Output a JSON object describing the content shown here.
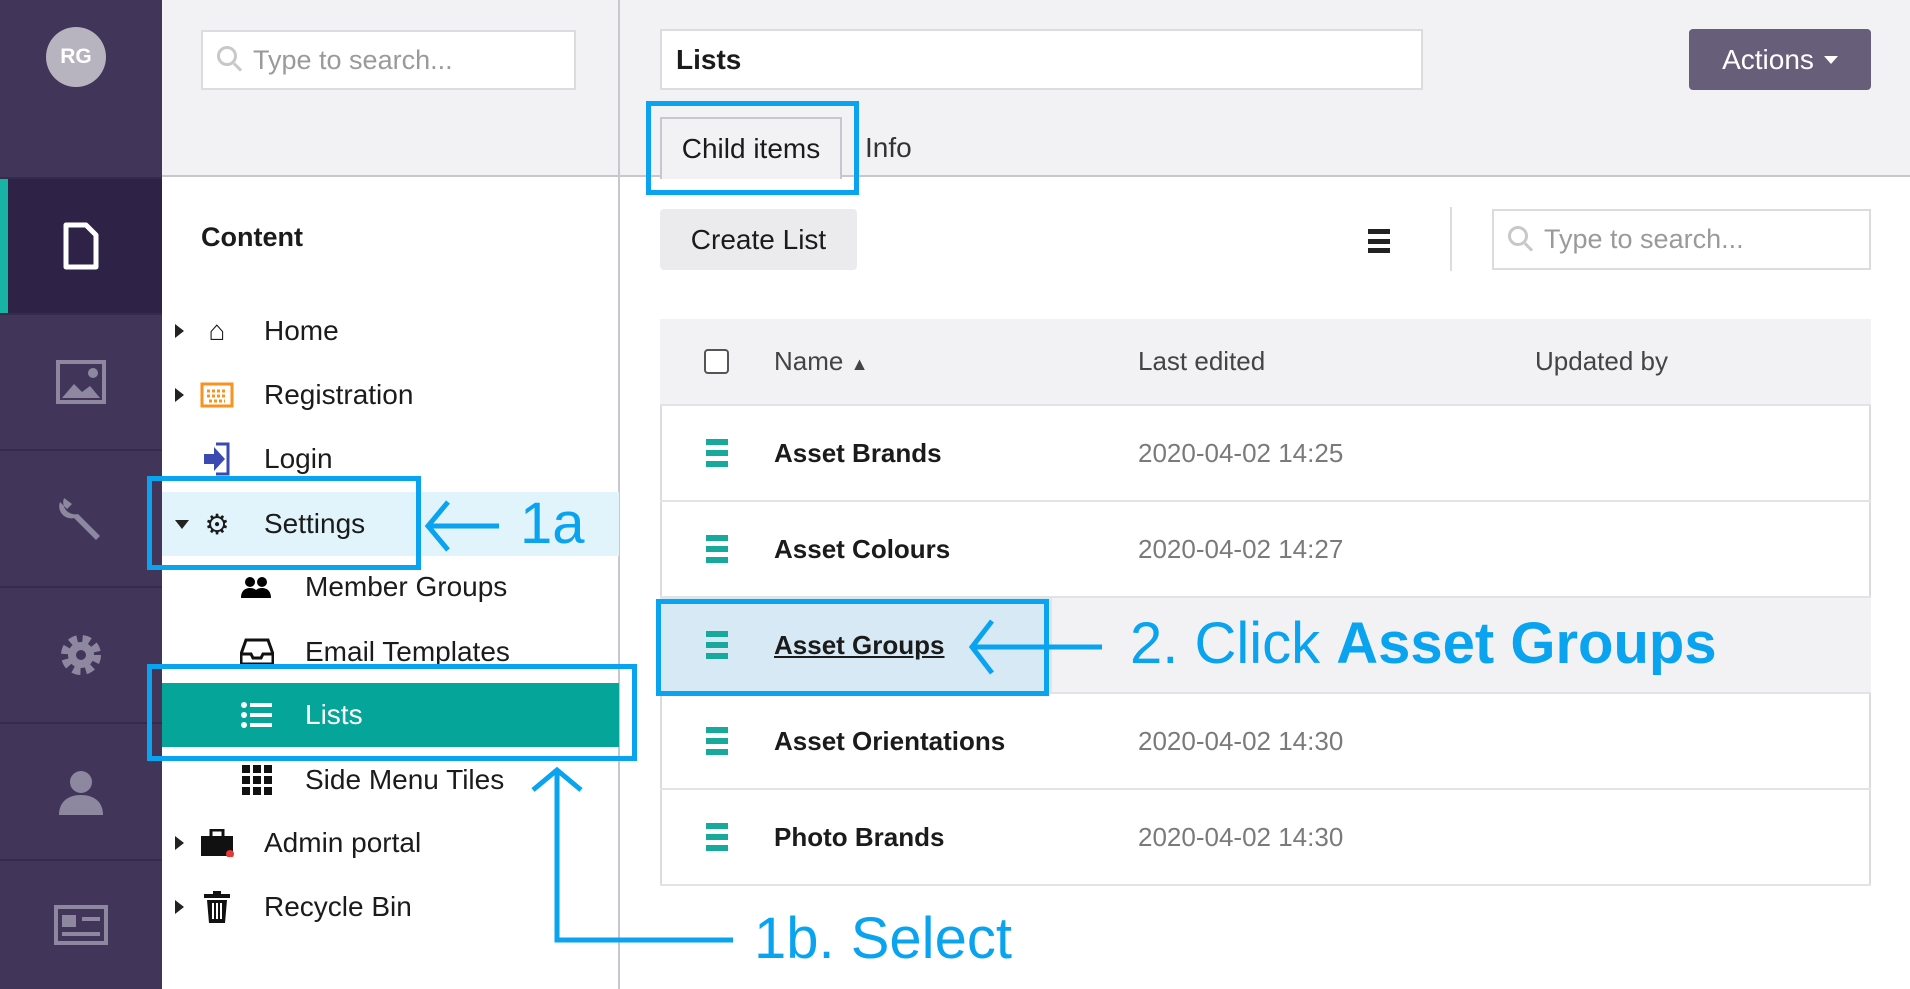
{
  "user": {
    "initials": "RG"
  },
  "nav": {
    "items": [
      {
        "name": "content",
        "icon": "document-icon"
      },
      {
        "name": "media",
        "icon": "image-icon"
      },
      {
        "name": "settings",
        "icon": "wrench-icon"
      },
      {
        "name": "packages",
        "icon": "gear-icon"
      },
      {
        "name": "members",
        "icon": "user-icon"
      },
      {
        "name": "forms",
        "icon": "id-card-icon"
      }
    ]
  },
  "tree": {
    "search_placeholder": "Type to search...",
    "title": "Content",
    "items": [
      {
        "label": "Home",
        "icon": "home-icon"
      },
      {
        "label": "Registration",
        "icon": "keyboard-icon"
      },
      {
        "label": "Login",
        "icon": "sign-in-icon"
      },
      {
        "label": "Settings",
        "icon": "gear-icon"
      },
      {
        "label": "Member Groups",
        "icon": "users-icon"
      },
      {
        "label": "Email Templates",
        "icon": "inbox-icon"
      },
      {
        "label": "Lists",
        "icon": "list-icon"
      },
      {
        "label": "Side Menu Tiles",
        "icon": "grid-icon"
      },
      {
        "label": "Admin portal",
        "icon": "briefcase-icon"
      },
      {
        "label": "Recycle Bin",
        "icon": "trash-icon"
      }
    ]
  },
  "header": {
    "title_value": "Lists",
    "actions_label": "Actions",
    "tabs": [
      {
        "label": "Child items",
        "active": true
      },
      {
        "label": "Info"
      }
    ]
  },
  "toolbar": {
    "create_label": "Create List",
    "search_placeholder": "Type to search..."
  },
  "table": {
    "columns": [
      "Name",
      "Last edited",
      "Updated by"
    ],
    "rows": [
      {
        "name": "Asset Brands",
        "last_edited": "2020-04-02 14:25",
        "updated_by": ""
      },
      {
        "name": "Asset Colours",
        "last_edited": "2020-04-02 14:27",
        "updated_by": ""
      },
      {
        "name": "Asset Groups",
        "last_edited": "",
        "updated_by": ""
      },
      {
        "name": "Asset Orientations",
        "last_edited": "2020-04-02 14:30",
        "updated_by": ""
      },
      {
        "name": "Photo Brands",
        "last_edited": "2020-04-02 14:30",
        "updated_by": ""
      }
    ]
  },
  "annotations": {
    "step1a": "1a",
    "step1b": "1b. Select",
    "step2_prefix": "2. Click ",
    "step2_bold": "Asset Groups"
  },
  "colors": {
    "nav_bg": "#413659",
    "accent_teal": "#06a59a",
    "annotation_blue": "#0aa3f0",
    "actions_bg": "#675f7a"
  }
}
